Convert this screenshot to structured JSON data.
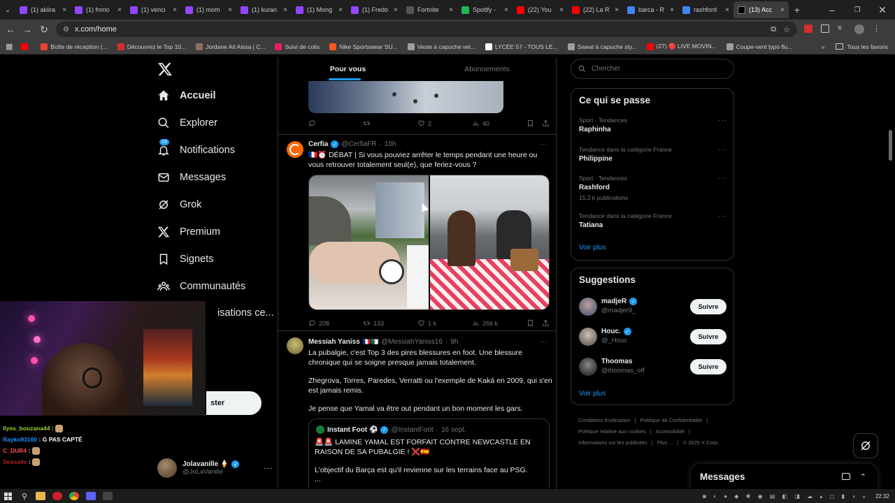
{
  "browser": {
    "tabs": [
      {
        "label": "(1) akiira",
        "color": "#9146ff"
      },
      {
        "label": "(1) fnmo",
        "color": "#9146ff"
      },
      {
        "label": "(1) venci",
        "color": "#9146ff"
      },
      {
        "label": "(1) mom",
        "color": "#9146ff"
      },
      {
        "label": "(1) kuran",
        "color": "#9146ff"
      },
      {
        "label": "(1) Mong",
        "color": "#9146ff"
      },
      {
        "label": "(1) Fredo",
        "color": "#9146ff"
      },
      {
        "label": "Fortnite",
        "color": "#555555"
      },
      {
        "label": "Spotify -",
        "color": "#1db954"
      },
      {
        "label": "(22) You",
        "color": "#ff0000"
      },
      {
        "label": "(22) La R",
        "color": "#ff0000"
      },
      {
        "label": "barca - R",
        "color": "#4285f4"
      },
      {
        "label": "rashford",
        "color": "#4285f4"
      },
      {
        "label": "(13) Acc",
        "color": "#000000",
        "active": true
      }
    ],
    "url": "x.com/home",
    "bookmarks": [
      {
        "label": "",
        "color": "#ff0000"
      },
      {
        "label": "Boîte de réception (...",
        "color": "#ea4335"
      },
      {
        "label": "Découvrez le Top 10...",
        "color": "#d32f2f"
      },
      {
        "label": "Jordane Ait Aissa | C...",
        "color": "#8d6e63"
      },
      {
        "label": "Suivi de colis",
        "color": "#e91e63"
      },
      {
        "label": "Nike Sportswear SU...",
        "color": "#ff5722"
      },
      {
        "label": "Veste à capuche vel...",
        "color": "#9e9e9e"
      },
      {
        "label": "LYCÉE 57 - TOUS LE...",
        "color": "#ffffff"
      },
      {
        "label": "Sweat à capuche sty...",
        "color": "#9e9e9e"
      },
      {
        "label": "(27) 🔴 LIVE MOVIN...",
        "color": "#ff0000"
      },
      {
        "label": "Coupe-vent typo flu...",
        "color": "#9e9e9e"
      }
    ],
    "all_bookmarks": "Tous les favoris",
    "time": "22:32"
  },
  "nav": {
    "items": [
      {
        "label": "Accueil",
        "icon": "home-icon"
      },
      {
        "label": "Explorer",
        "icon": "search-icon"
      },
      {
        "label": "Notifications",
        "icon": "bell-icon",
        "badge": "13"
      },
      {
        "label": "Messages",
        "icon": "mail-icon"
      },
      {
        "label": "Grok",
        "icon": "grok-icon"
      },
      {
        "label": "Premium",
        "icon": "x-logo-icon"
      },
      {
        "label": "Signets",
        "icon": "bookmark-icon"
      },
      {
        "label": "Communautés",
        "icon": "people-icon"
      },
      {
        "label": "isations ce...",
        "icon": ""
      }
    ],
    "post_button": "ster",
    "account": {
      "name": "Jolavanille 🍦",
      "handle": "@JoLaVanille"
    }
  },
  "feed": {
    "tabs": [
      "Pour vous",
      "Abonnements"
    ],
    "top_actions": {
      "replies": "",
      "retweets": "",
      "likes": "2",
      "views": "40"
    },
    "tweets": [
      {
        "name": "Cerfia",
        "handle": "@CerfiaFR",
        "time": "10h",
        "text": "🇫🇷⏰ DÉBAT | Si vous pouviez arrêter le temps pendant une heure ou vous retrouver totalement seul(e), que feriez-vous ?",
        "replies": "208",
        "retweets": "133",
        "likes": "1 k",
        "views": "266 k"
      },
      {
        "name": "Messiah Yaniss",
        "flags": "🇫🇷🇩🇿",
        "handle": "@MessiahYaniss16",
        "time": "9h",
        "p1": "La pubalgie, c'est Top 3 des pires blessures en foot. Une blessure chronique qui se soigne presque jamais totalement.",
        "p2": "Zhegrova, Torres, Paredes, Verratti ou l'exemple de Kaká en 2009, qui s'en est jamais remis.",
        "p3": "Je pense que Yamal va être out pendant un bon moment les gars.",
        "quote": {
          "name": "Instant Foot ⚽",
          "handle": "@InstantFoot",
          "time": "16 sept.",
          "text": "🚨🚨 LAMINE YAMAL EST FORFAIT CONTRE NEWCASTLE EN RAISON DE SA PUBALGIE ! ❌🇪🇸",
          "text2": "L'objectif du Barça est qu'il revienne sur les terrains face au PSG.",
          "more": "..."
        }
      }
    ]
  },
  "sidebar": {
    "search_placeholder": "Chercher",
    "trends_title": "Ce qui se passe",
    "trends": [
      {
        "meta": "Sport · Tendances",
        "name": "Raphinha",
        "count": ""
      },
      {
        "meta": "Tendance dans la catégorie France",
        "name": "Philippine",
        "count": ""
      },
      {
        "meta": "Sport · Tendances",
        "name": "Rashford",
        "count": "15,2 k publications"
      },
      {
        "meta": "Tendance dans la catégorie France",
        "name": "Tatiana",
        "count": ""
      }
    ],
    "see_more": "Voir plus",
    "suggestions_title": "Suggestions",
    "suggestions": [
      {
        "name": "madjeR",
        "handle": "@madjer9_",
        "verified": true
      },
      {
        "name": "Houc.",
        "handle": "@_Houc",
        "verified": true
      },
      {
        "name": "Thoomas",
        "handle": "@thoomas_off",
        "verified": false
      }
    ],
    "follow_label": "Suivre",
    "footer": [
      "Conditions d'utilisation",
      "Politique de Confidentialité",
      "Politique relative aux cookies",
      "Accessibilité",
      "Informations sur les publicités",
      "Plus ...",
      "© 2025 X Corp."
    ],
    "messages_label": "Messages"
  },
  "chat": [
    {
      "user": "Ilyes_bouzana44",
      "text": "",
      "color": "#9acd32"
    },
    {
      "user": "Rayko93160",
      "text": "G PAS CAPTÉ",
      "color": "#1e90ff"
    },
    {
      "user": "C_DUR4",
      "text": "",
      "color": "#ff4d4d"
    },
    {
      "user": "Sossa4x",
      "text": "",
      "color": "#b22222"
    }
  ]
}
